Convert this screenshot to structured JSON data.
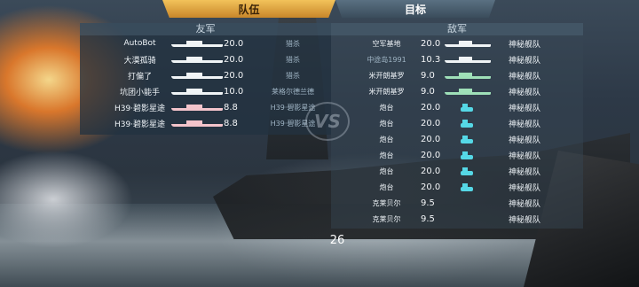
{
  "tabs": {
    "team": "队伍",
    "target": "目标"
  },
  "ally": {
    "header": "友军",
    "rows": [
      {
        "name": "AutoBot",
        "value": "20.0",
        "ship": "白",
        "rank": "猎杀"
      },
      {
        "name": "大漠孤骑",
        "value": "20.0",
        "ship": "白",
        "rank": "猎杀"
      },
      {
        "name": "打偏了",
        "value": "20.0",
        "ship": "白",
        "rank": "猎杀"
      },
      {
        "name": "坑团小能手",
        "value": "10.0",
        "ship": "白",
        "rank": "莱格尔德兰德"
      },
      {
        "name": "H39·碧影星途",
        "value": "8.8",
        "ship": "粉",
        "rank": "H39·碧影星途"
      },
      {
        "name": "H39·碧影星途",
        "value": "8.8",
        "ship": "粉",
        "rank": "H39·碧影星途"
      }
    ]
  },
  "enemy": {
    "header": "敌军",
    "rows": [
      {
        "name": "空军基地",
        "value": "20.0",
        "side": "神秘舰队"
      },
      {
        "name": "中途岛1991",
        "value": "10.3",
        "side": "神秘舰队"
      },
      {
        "name": "米开朗基罗",
        "value": "9.0",
        "side": "神秘舰队"
      },
      {
        "name": "米开朗基罗",
        "value": "9.0",
        "side": "神秘舰队"
      },
      {
        "name": "炮台",
        "value": "20.0",
        "side": "神秘舰队"
      },
      {
        "name": "炮台",
        "value": "20.0",
        "side": "神秘舰队"
      },
      {
        "name": "炮台",
        "value": "20.0",
        "side": "神秘舰队"
      },
      {
        "name": "炮台",
        "value": "20.0",
        "side": "神秘舰队"
      },
      {
        "name": "炮台",
        "value": "20.0",
        "side": "神秘舰队"
      },
      {
        "name": "炮台",
        "value": "20.0",
        "side": "神秘舰队"
      },
      {
        "name": "克莱贝尔",
        "value": "9.5",
        "side": "神秘舰队"
      },
      {
        "name": "克莱贝尔",
        "value": "9.5",
        "side": "神秘舰队"
      }
    ]
  },
  "vs_label": "VS",
  "counter": "26"
}
